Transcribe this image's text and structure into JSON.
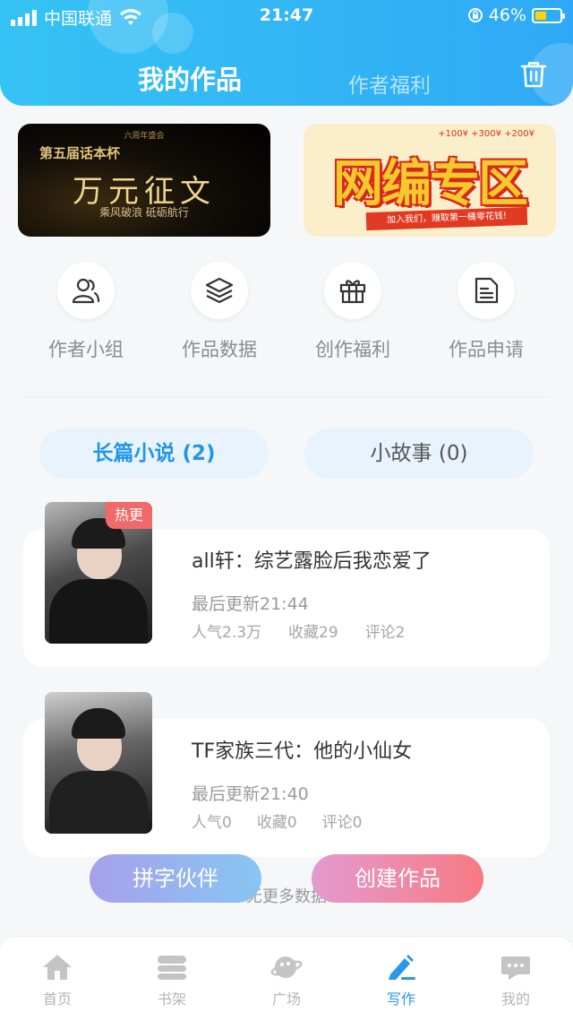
{
  "status_bar": {
    "carrier": "中国联通",
    "time": "21:47",
    "battery": "46%",
    "battery_level": 0.46
  },
  "header": {
    "title": "我的作品",
    "secondary_tab": "作者福利",
    "trash_icon": "trash-icon"
  },
  "banners": [
    {
      "name": "essay-contest",
      "small_text": "六周年盛会",
      "subtitle": "第五届话本杯",
      "title": "万元征文",
      "slogan": "乘风破浪 砥砺航行"
    },
    {
      "name": "web-editor-zone",
      "coins": "+100¥  +300¥  +200¥",
      "title": "网编专区",
      "ribbon": "加入我们，赚取第一桶零花钱!"
    }
  ],
  "quick_actions": [
    {
      "label": "作者小组",
      "icon": "author-group-icon"
    },
    {
      "label": "作品数据",
      "icon": "layers-icon"
    },
    {
      "label": "创作福利",
      "icon": "gift-icon"
    },
    {
      "label": "作品申请",
      "icon": "document-icon"
    }
  ],
  "segments": {
    "novels": "长篇小说 (2)",
    "stories": "小故事 (0)"
  },
  "works": [
    {
      "badge": "热更",
      "title": "all轩：综艺露脸后我恋爱了",
      "updated": "最后更新21:44",
      "popularity": "人气2.3万",
      "favorites": "收藏29",
      "comments": "评论2"
    },
    {
      "title": "TF家族三代：他的小仙女",
      "updated": "最后更新21:40",
      "popularity": "人气0",
      "favorites": "收藏0",
      "comments": "评论0"
    }
  ],
  "no_more": "无更多数据",
  "fab": {
    "partner": "拼字伙伴",
    "create": "创建作品"
  },
  "tabbar": [
    {
      "label": "首页",
      "icon": "home-icon"
    },
    {
      "label": "书架",
      "icon": "bookshelf-icon"
    },
    {
      "label": "广场",
      "icon": "planet-icon"
    },
    {
      "label": "写作",
      "icon": "pen-icon",
      "active": true
    },
    {
      "label": "我的",
      "icon": "chat-icon"
    }
  ],
  "colors": {
    "header": "#2fa9f6",
    "accent": "#2196e8",
    "hot_badge": "#f06a6a"
  }
}
